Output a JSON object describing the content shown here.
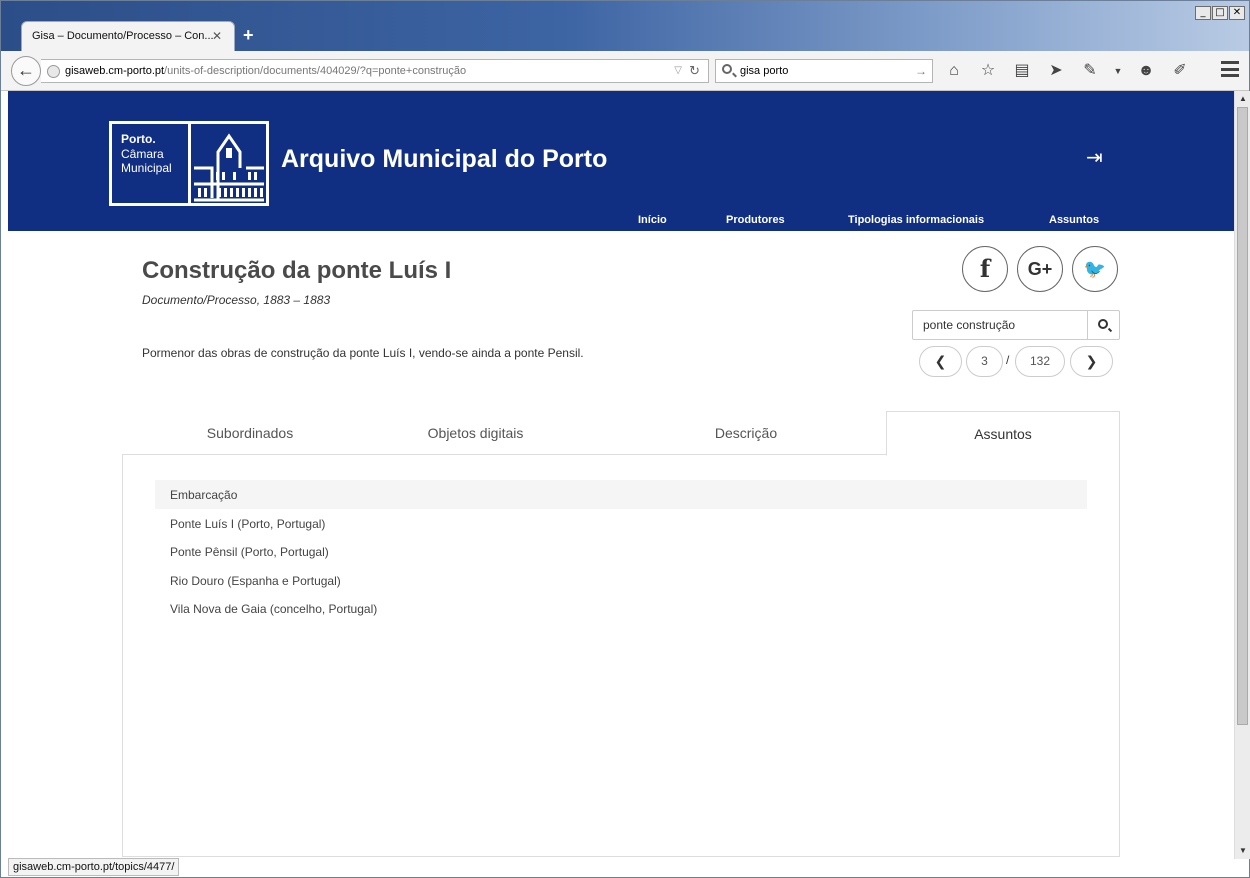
{
  "browser": {
    "tab_title": "Gisa – Documento/Processo – Con...",
    "tab_close": "✕",
    "new_tab": "+",
    "url_host": "gisaweb.cm-porto.pt",
    "url_path": "/units-of-description/documents/404029/?q=ponte+construção",
    "search_value": "gisa porto",
    "status_url": "gisaweb.cm-porto.pt/topics/4477/"
  },
  "site": {
    "logo_line1": "Porto.",
    "logo_line2": "Câmara",
    "logo_line3": "Municipal",
    "title": "Arquivo Municipal do Porto",
    "nav": [
      "Início",
      "Produtores",
      "Tipologias informacionais",
      "Assuntos"
    ]
  },
  "document": {
    "title": "Construção da ponte Luís I",
    "subtitle": "Documento/Processo, 1883 – 1883",
    "description": "Pormenor das obras de construção da ponte Luís I, vendo-se ainda a ponte Pensil."
  },
  "social": {
    "facebook": "f",
    "googleplus": "G+",
    "twitter": "🐦"
  },
  "search": {
    "value": "ponte construção"
  },
  "pager": {
    "current": "3",
    "separator": "/",
    "total": "132"
  },
  "tabs": [
    "Subordinados",
    "Objetos digitais",
    "Descrição",
    "Assuntos"
  ],
  "topics": [
    "Embarcação",
    "Ponte Luís I (Porto, Portugal)",
    "Ponte Pênsil (Porto, Portugal)",
    "Rio Douro (Espanha e Portugal)",
    "Vila Nova de Gaia (concelho, Portugal)"
  ],
  "colors": {
    "header_bg": "#102f82",
    "tab_highlight": "#f5f5f5"
  }
}
